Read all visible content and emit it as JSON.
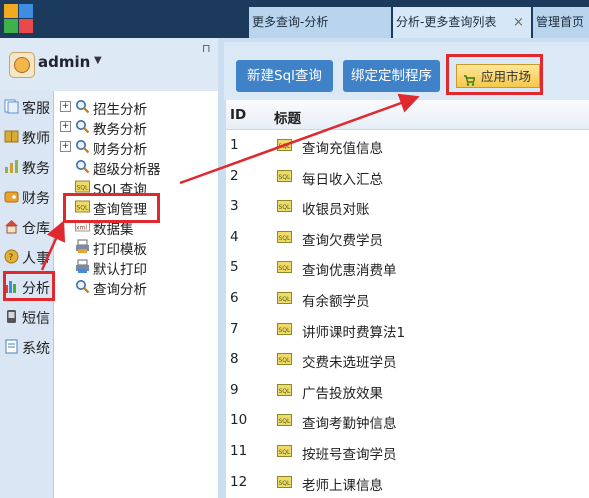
{
  "tabs": [
    {
      "label": "更多查询-分析"
    },
    {
      "label": "分析-更多查询列表",
      "close": "×"
    },
    {
      "label": "管理首页"
    }
  ],
  "user": {
    "name": "admin",
    "caret": "▼",
    "pin": "⊓"
  },
  "leftnav": [
    {
      "label": "客服",
      "icon": "pages-icon",
      "color": "#5b8fd0"
    },
    {
      "label": "教师",
      "icon": "book-icon",
      "color": "#d9a93a"
    },
    {
      "label": "教务",
      "icon": "chart-icon",
      "color": "#8fb34a"
    },
    {
      "label": "财务",
      "icon": "wallet-icon",
      "color": "#e8a22d"
    },
    {
      "label": "仓库",
      "icon": "house-icon",
      "color": "#d04a3a"
    },
    {
      "label": "人事",
      "icon": "person-icon",
      "color": "#e2b23a"
    },
    {
      "label": "分析",
      "icon": "bar-chart-icon",
      "color": "#d83f3f"
    },
    {
      "label": "短信",
      "icon": "phone-icon",
      "color": "#555555"
    },
    {
      "label": "系统",
      "icon": "notebook-icon",
      "color": "#4a7fb8"
    }
  ],
  "tree": [
    {
      "label": "招生分析",
      "expand": "+",
      "icon": "search-icon"
    },
    {
      "label": "教务分析",
      "expand": "+",
      "icon": "search-icon"
    },
    {
      "label": "财务分析",
      "expand": "+",
      "icon": "search-icon"
    },
    {
      "label": "超级分析器",
      "expand": "",
      "icon": "search-icon"
    },
    {
      "label": "SQL查询",
      "expand": "",
      "icon": "sql-icon"
    },
    {
      "label": "查询管理",
      "expand": "",
      "icon": "sql-icon"
    },
    {
      "label": "数据集",
      "expand": "",
      "icon": "xml-icon"
    },
    {
      "label": "打印模板",
      "expand": "",
      "icon": "printer-icon"
    },
    {
      "label": "默认打印",
      "expand": "",
      "icon": "printer-icon"
    },
    {
      "label": "查询分析",
      "expand": "",
      "icon": "search-icon"
    }
  ],
  "toolbar": {
    "new_label": "新建Sql查询",
    "bind_label": "绑定定制程序",
    "app_label": "应用市场"
  },
  "table": {
    "headers": {
      "id": "ID",
      "title": "标题"
    },
    "rows": [
      {
        "id": "1",
        "title": "查询充值信息"
      },
      {
        "id": "2",
        "title": "每日收入汇总"
      },
      {
        "id": "3",
        "title": "收银员对账"
      },
      {
        "id": "4",
        "title": "查询欠费学员"
      },
      {
        "id": "5",
        "title": "查询优惠消费单"
      },
      {
        "id": "6",
        "title": "有余额学员"
      },
      {
        "id": "7",
        "title": "讲师课时费算法1"
      },
      {
        "id": "8",
        "title": "交费未选班学员"
      },
      {
        "id": "9",
        "title": "广告投放效果"
      },
      {
        "id": "10",
        "title": "查询考勤钟信息"
      },
      {
        "id": "11",
        "title": "按班号查询学员"
      },
      {
        "id": "12",
        "title": "老师上课信息"
      }
    ]
  },
  "colors": {
    "annotation": "#e0282f",
    "button": "#3f82c8",
    "header_bar": "#1b3a5c"
  }
}
